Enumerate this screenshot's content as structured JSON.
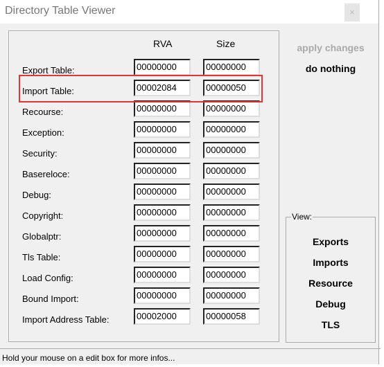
{
  "window": {
    "title": "Directory Table Viewer",
    "close": "×"
  },
  "columns": {
    "rva": "RVA",
    "size": "Size"
  },
  "rows": [
    {
      "label": "Export Table:",
      "rva": "00000000",
      "size": "00000000"
    },
    {
      "label": "Import Table:",
      "rva": "00002084",
      "size": "00000050"
    },
    {
      "label": "Recourse:",
      "rva": "00000000",
      "size": "00000000"
    },
    {
      "label": "Exception:",
      "rva": "00000000",
      "size": "00000000"
    },
    {
      "label": "Security:",
      "rva": "00000000",
      "size": "00000000"
    },
    {
      "label": "Basereloce:",
      "rva": "00000000",
      "size": "00000000"
    },
    {
      "label": "Debug:",
      "rva": "00000000",
      "size": "00000000"
    },
    {
      "label": "Copyright:",
      "rva": "00000000",
      "size": "00000000"
    },
    {
      "label": "Globalptr:",
      "rva": "00000000",
      "size": "00000000"
    },
    {
      "label": "Tls Table:",
      "rva": "00000000",
      "size": "00000000"
    },
    {
      "label": "Load Config:",
      "rva": "00000000",
      "size": "00000000"
    },
    {
      "label": "Bound Import:",
      "rva": "00000000",
      "size": "00000000"
    },
    {
      "label": "Import Address Table:",
      "rva": "00002000",
      "size": "00000058"
    }
  ],
  "actions": {
    "apply": "apply changes",
    "nothing": "do nothing"
  },
  "view": {
    "label": "View:",
    "buttons": [
      "Exports",
      "Imports",
      "Resource",
      "Debug",
      "TLS"
    ]
  },
  "status": "Hold your mouse on a edit box for more infos...",
  "highlight_color": "#e63333"
}
